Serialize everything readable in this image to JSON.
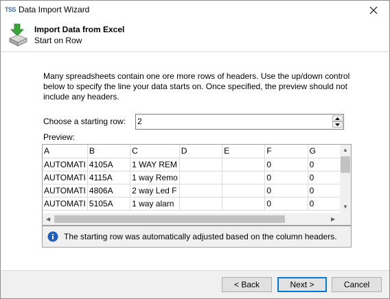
{
  "window": {
    "app_icon_text": "TSS",
    "title": "Data Import Wizard"
  },
  "header": {
    "title": "Import Data from Excel",
    "subtitle": "Start on Row",
    "icon": "excel-import-icon"
  },
  "intro_text": "Many spreadsheets contain one ore more rows of headers. Use the up/down control below to specify the line your data starts on. Once specified, the preview should not include any headers.",
  "start_row": {
    "label": "Choose a starting row:",
    "value": "2"
  },
  "preview": {
    "label": "Preview:",
    "columns": [
      "A",
      "B",
      "C",
      "D",
      "E",
      "F",
      "G"
    ],
    "rows": [
      [
        "AUTOMATI",
        "4105A",
        "1 WAY REM",
        "",
        "",
        "0",
        "0"
      ],
      [
        "AUTOMATI",
        "4115A",
        "1 way Remo",
        "",
        "",
        "0",
        "0"
      ],
      [
        "AUTOMATI",
        "4806A",
        "2 way Led F",
        "",
        "",
        "0",
        "0"
      ],
      [
        "AUTOMATI",
        "5105A",
        "1 way alarn",
        "",
        "",
        "0",
        "0"
      ]
    ]
  },
  "info": {
    "icon": "info-icon",
    "text": "The starting row was automatically adjusted based on the column headers."
  },
  "buttons": {
    "back": "< Back",
    "next": "Next >",
    "cancel": "Cancel"
  },
  "colors": {
    "accent": "#0078d7",
    "info_icon": "#1f5fbf",
    "arrow_green": "#3aa63a"
  }
}
